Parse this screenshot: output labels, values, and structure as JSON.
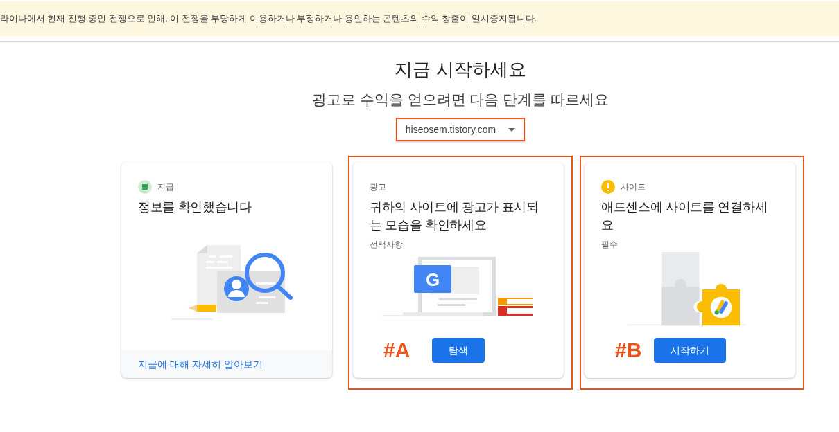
{
  "banner": {
    "text": "라이나에서 현재 진행 중인 전쟁으로 인해, 이 전쟁을 부당하게 이용하거나 부정하거나 용인하는 콘텐츠의 수익 창출이 일시중지됩니다."
  },
  "heading": "지금 시작하세요",
  "subheading": "광고로 수익을 얻으려면 다음 단계를 따르세요",
  "site_select": {
    "value": "hiseosem.tistory.com",
    "highlighted": true
  },
  "cards": [
    {
      "kind": "payments",
      "completed": true,
      "needs_action": false,
      "label": "지급",
      "title": "정보를 확인했습니다",
      "footer_link": "지급에 대해 자세히 알아보기",
      "highlighted": false
    },
    {
      "kind": "ads",
      "completed": false,
      "needs_action": false,
      "logo_letter": "G",
      "label": "광고",
      "title": "귀하의 사이트에 광고가 표시되는 모습을 확인하세요",
      "note": "선택사항",
      "button": "탐색",
      "highlighted": true,
      "annotation": "#A"
    },
    {
      "kind": "site",
      "completed": false,
      "needs_action": true,
      "label": "사이트",
      "title": "애드센스에 사이트를 연결하세요",
      "note": "필수",
      "button": "시작하기",
      "highlighted": true,
      "annotation": "#B"
    }
  ]
}
